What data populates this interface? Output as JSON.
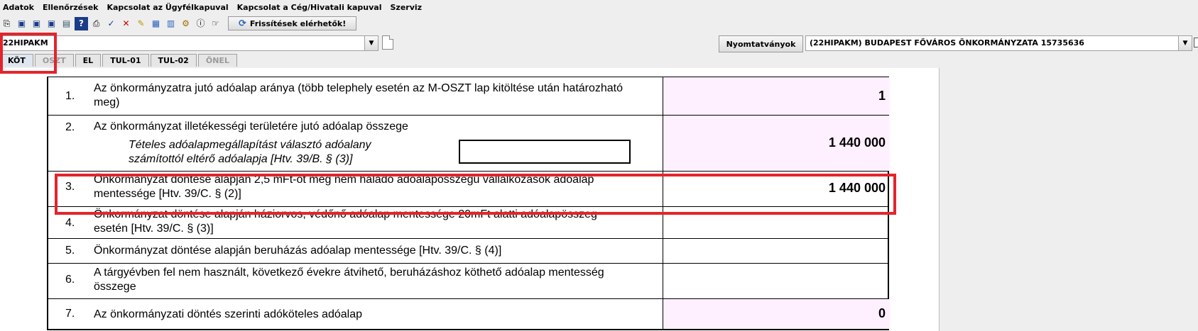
{
  "menu": [
    "Adatok",
    "Ellenőrzések",
    "Kapcsolat az Ügyfélkapuval",
    "Kapcsolat a Cég/Hivatali kapuval",
    "Szerviz"
  ],
  "toolbar": {
    "icons": [
      "copy-icon",
      "save-icon",
      "save-new-icon",
      "save-as-icon",
      "edit-icon",
      "info-doc-icon",
      "print-icon",
      "check-icon",
      "delete-icon",
      "edit-pencil-icon",
      "calculator-icon",
      "calc-list-icon",
      "tool-icon",
      "info-icon",
      "settings-icon"
    ],
    "update_label": "Frissítések elérhetők!"
  },
  "form_selector": {
    "value": "22HIPAKM"
  },
  "nyomtatvanyok_label": "Nyomtatványok",
  "org_selector": {
    "value": "(22HIPAKM) BUDAPEST FŐVÁROS ÖNKORMÁNYZATA 15735636"
  },
  "tabs": [
    {
      "label": "KÖT",
      "state": "active"
    },
    {
      "label": "OSZT",
      "state": "disabled"
    },
    {
      "label": "EL",
      "state": "normal"
    },
    {
      "label": "TUL-01",
      "state": "normal"
    },
    {
      "label": "TUL-02",
      "state": "normal"
    },
    {
      "label": "ÖNEL",
      "state": "disabled"
    }
  ],
  "rows": [
    {
      "num": "1.",
      "text": "Az önkormányzatra jutó adóalap aránya (több telephely esetén az M-OSZT lap kitöltése után határozható meg)",
      "value": "1"
    },
    {
      "num": "2.",
      "text": "Az önkormányzat illetékességi területére jutó adóalap összege",
      "sub": "Tételes adóalapmegállapítást választó adóalany számítottól eltérő adóalapja [Htv. 39/B. § (3)]",
      "value": "1 440 000"
    },
    {
      "num": "3.",
      "text": "Önkormányzat döntése alapján 2,5 mFt-ot meg nem haladó adóalapösszegű vállalkozások adóalap mentessége [Htv. 39/C. § (2)]",
      "value": "1 440 000"
    },
    {
      "num": "4.",
      "text": "Önkormányzat döntése alapján háziorvos, védőnő adóalap mentessége 20mFt alatti adóalapösszeg esetén [Htv. 39/C. § (3)]",
      "value": ""
    },
    {
      "num": "5.",
      "text": "Önkormányzat döntése alapján beruházás adóalap mentessége [Htv. 39/C. § (4)]",
      "value": ""
    },
    {
      "num": "6.",
      "text": "A tárgyévben fel nem használt, következő évekre átvihető, beruházáshoz köthető adóalap mentesség összege",
      "value": ""
    },
    {
      "num": "7.",
      "text": "Az önkormányzati döntés szerinti adóköteles adóalap",
      "value": "0"
    }
  ],
  "colors": {
    "highlight": "#e3242b",
    "pink_cell": "#fff0ff"
  }
}
